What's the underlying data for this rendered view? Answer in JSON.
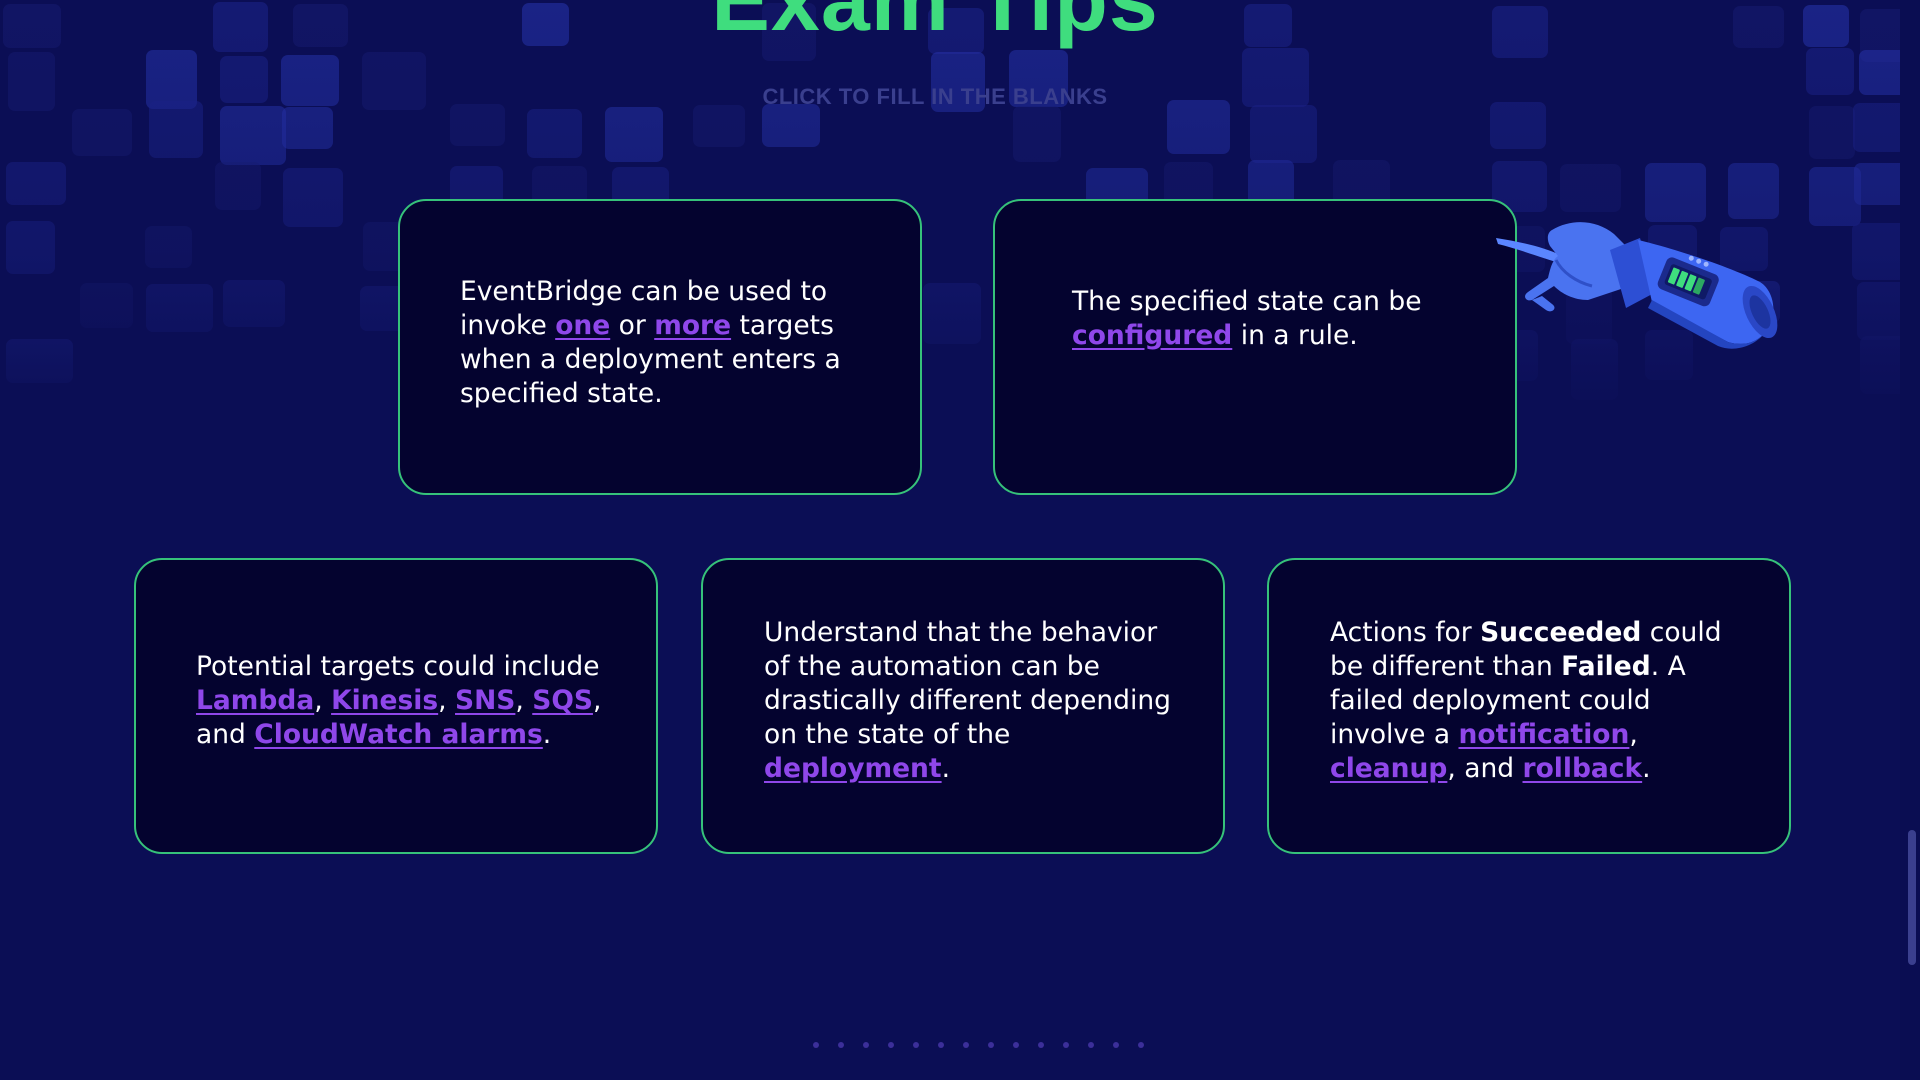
{
  "header": {
    "title": "Exam Tips",
    "subtitle": "CLICK TO FILL IN THE BLANKS"
  },
  "cards": [
    {
      "parts": {
        "t1": "EventBridge can be used to invoke ",
        "b1": "one",
        "t2": " or ",
        "b2": "more",
        "t3": " targets when a deployment enters a specified state."
      }
    },
    {
      "parts": {
        "t1": "The specified state can be ",
        "b1": "configured",
        "t2": " in a rule."
      }
    },
    {
      "parts": {
        "t1": "Potential targets could include ",
        "b1": "Lambda",
        "t2": ", ",
        "b2": "Kinesis",
        "t3": ", ",
        "b3": "SNS",
        "t4": ", ",
        "b4": "SQS",
        "t5": ", and ",
        "b5": "CloudWatch alarms",
        "t6": "."
      }
    },
    {
      "parts": {
        "t1": "Understand that the behavior of the automation can be drastically different depending on the state of the ",
        "b1": "deployment",
        "t2": "."
      }
    },
    {
      "parts": {
        "t1": "Actions for ",
        "s1": "Succeeded",
        "t2": " could be different than ",
        "s2": "Failed",
        "t3": ". A failed deployment could involve a ",
        "b1": "notification",
        "t4": ", ",
        "b2": "cleanup",
        "t5": ", and ",
        "b3": "rollback",
        "t6": "."
      }
    }
  ],
  "pagination": {
    "dot_count": 14
  },
  "colors": {
    "background": "#0b0e55",
    "card_background": "#04032f",
    "card_border": "#36c27a",
    "title": "#3fdd7e",
    "subtitle": "#3a3f8e",
    "blank_link": "#8f47ea",
    "text": "#ffffff"
  },
  "icons": {
    "decoration": "robot-arm-pointing-icon"
  }
}
